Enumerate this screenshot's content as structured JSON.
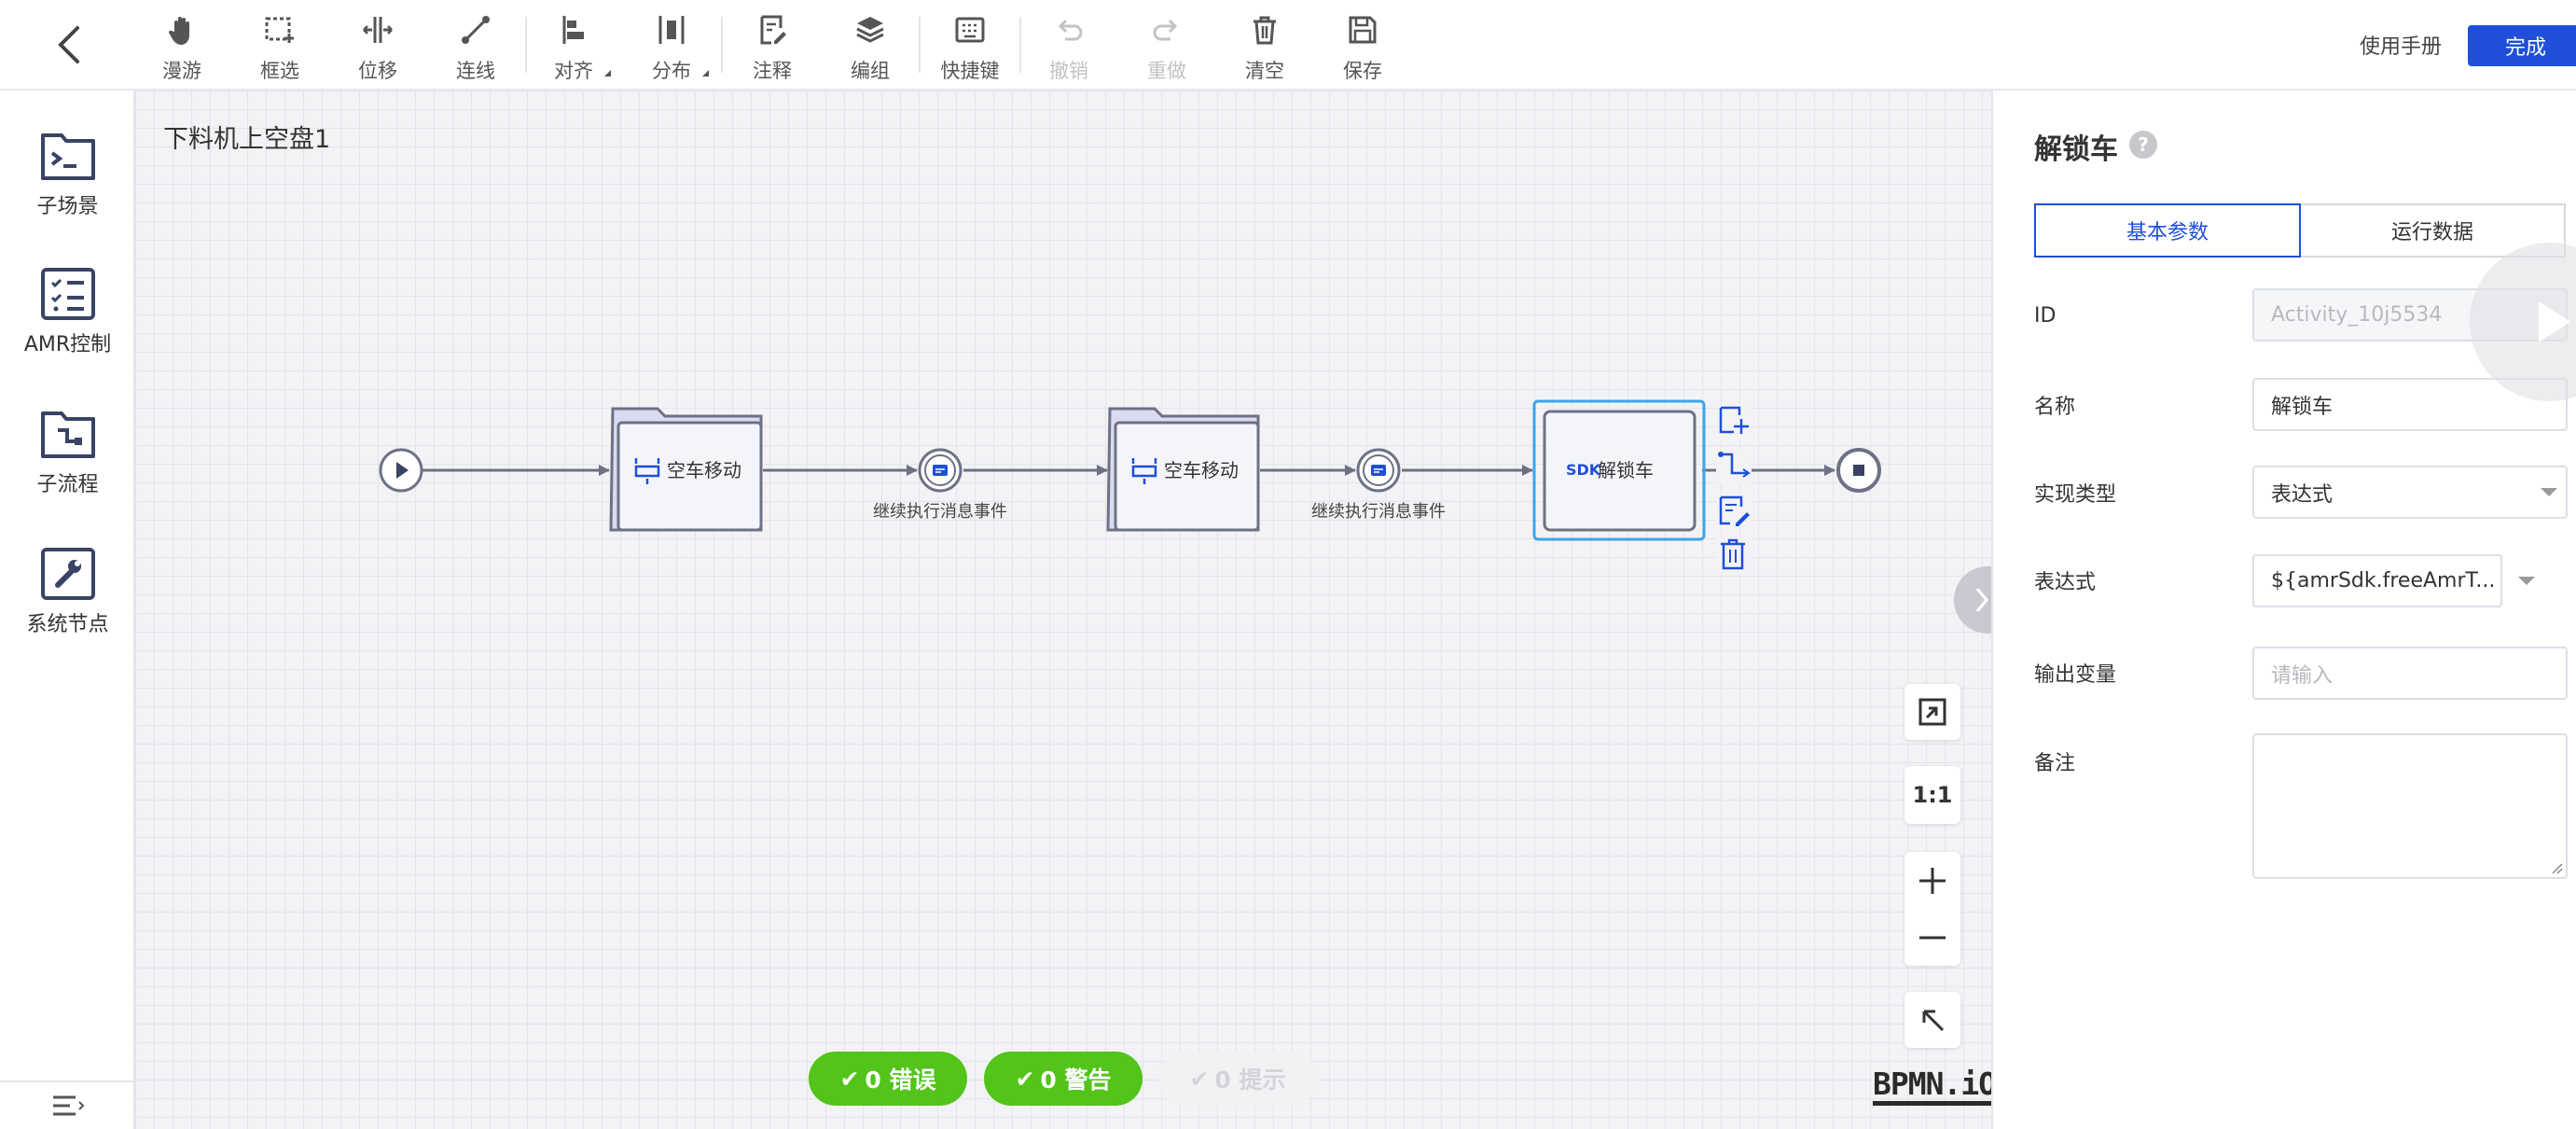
{
  "toolbar": {
    "tools": [
      {
        "label": "漫游",
        "icon": "hand-icon",
        "disabled": false
      },
      {
        "label": "框选",
        "icon": "marquee-select-icon",
        "disabled": false
      },
      {
        "label": "位移",
        "icon": "space-tool-icon",
        "disabled": false
      },
      {
        "label": "连线",
        "icon": "connect-icon",
        "disabled": false
      },
      {
        "label": "对齐",
        "icon": "align-left-icon",
        "disabled": false
      },
      {
        "label": "分布",
        "icon": "distribute-icon",
        "disabled": false
      },
      {
        "label": "注释",
        "icon": "annotation-icon",
        "disabled": false
      },
      {
        "label": "编组",
        "icon": "group-layers-icon",
        "disabled": false
      },
      {
        "label": "快捷键",
        "icon": "keyboard-icon",
        "disabled": false
      },
      {
        "label": "撤销",
        "icon": "undo-icon",
        "disabled": true
      },
      {
        "label": "重做",
        "icon": "redo-icon",
        "disabled": true
      },
      {
        "label": "清空",
        "icon": "trash-icon",
        "disabled": false
      },
      {
        "label": "保存",
        "icon": "save-icon",
        "disabled": false
      }
    ],
    "manual_label": "使用手册",
    "done_label": "完成"
  },
  "palette": {
    "items": [
      {
        "label": "子场景",
        "icon": "subscene-folder-icon"
      },
      {
        "label": "AMR控制",
        "icon": "checklist-icon"
      },
      {
        "label": "子流程",
        "icon": "subprocess-folder-icon"
      },
      {
        "label": "系统节点",
        "icon": "wrench-icon"
      }
    ]
  },
  "canvas": {
    "process_title": "下料机上空盘1",
    "nodes": {
      "task1": "空车移动",
      "event1": "继续执行消息事件",
      "task2": "空车移动",
      "event2": "继续执行消息事件",
      "task3_prefix": "SDK",
      "task3": "解锁车"
    },
    "zoom_reset_label": "1:1",
    "logo": "BPMN.iO"
  },
  "status": {
    "errors": "0 错误",
    "warnings": "0 警告",
    "hints": "0 提示"
  },
  "panel": {
    "title": "解锁车",
    "help": "?",
    "tabs": [
      "基本参数",
      "运行数据"
    ],
    "fields": {
      "id_label": "ID",
      "id_value": "Activity_10j5534",
      "name_label": "名称",
      "name_value": "解锁车",
      "type_label": "实现类型",
      "type_value": "表达式",
      "expr_label": "表达式",
      "expr_value": "${amrSdk.freeAmrT...",
      "output_label": "输出变量",
      "output_placeholder": "请输入",
      "remark_label": "备注"
    }
  },
  "colors": {
    "accent": "#1f4fd9",
    "success": "#52c41a",
    "selection": "#3ea4e8",
    "node_stroke": "#6e7185"
  }
}
